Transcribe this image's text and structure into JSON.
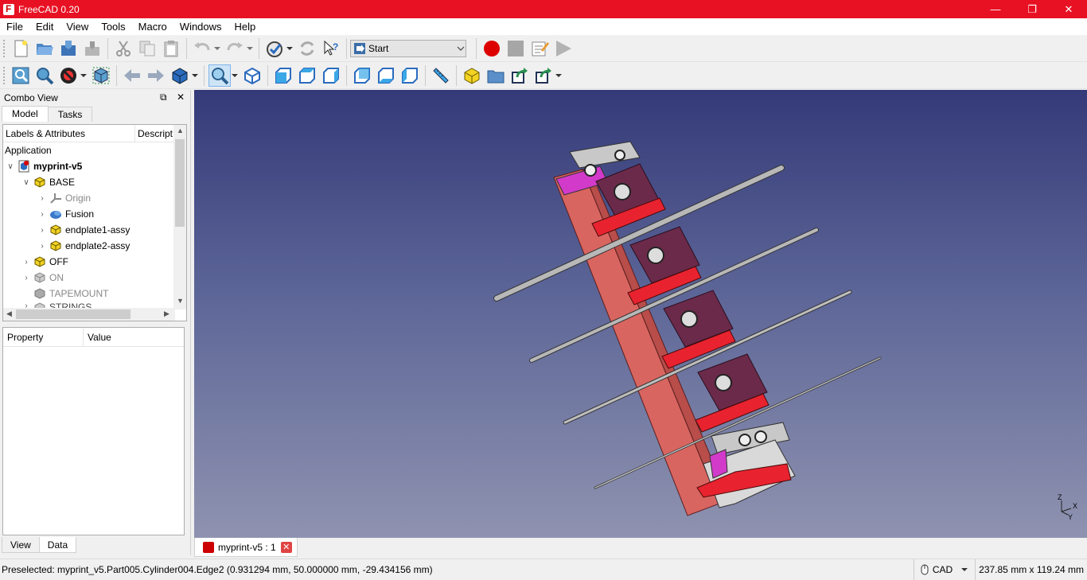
{
  "app": {
    "title": "FreeCAD 0.20"
  },
  "window_controls": {
    "minimize": "—",
    "restore": "❐",
    "close": "✕"
  },
  "menu": [
    "File",
    "Edit",
    "View",
    "Tools",
    "Macro",
    "Windows",
    "Help"
  ],
  "toolbar": {
    "workbench": "Start"
  },
  "combo_view": {
    "title": "Combo View",
    "tabs": [
      "Model",
      "Tasks"
    ],
    "tree_headers": [
      "Labels & Attributes",
      "Descript"
    ],
    "tree_root_label": "Application",
    "tree_items": [
      {
        "label": "myprint-v5",
        "icon": "document-icon"
      },
      {
        "label": "BASE",
        "icon": "part-icon"
      },
      {
        "label": "Origin",
        "icon": "origin-icon"
      },
      {
        "label": "Fusion",
        "icon": "fusion-icon"
      },
      {
        "label": "endplate1-assy",
        "icon": "part-icon"
      },
      {
        "label": "endplate2-assy",
        "icon": "part-icon"
      },
      {
        "label": "OFF",
        "icon": "part-icon"
      },
      {
        "label": "ON",
        "icon": "part-icon"
      },
      {
        "label": "TAPEMOUNT",
        "icon": "body-icon"
      },
      {
        "label": "STRINGS",
        "icon": "part-icon"
      }
    ],
    "property_headers": [
      "Property",
      "Value"
    ],
    "bottom_tabs": [
      "View",
      "Data"
    ]
  },
  "document_tab": {
    "label": "myprint-v5 : 1"
  },
  "axis_labels": {
    "z": "Z",
    "x": "X",
    "y": "Y"
  },
  "status": {
    "message": "Preselected: myprint_v5.Part005.Cylinder004.Edge2 (0.931294 mm, 50.000000 mm, -29.434156 mm)",
    "navigation_style": "CAD",
    "dimensions": "237.85 mm x 119.24 mm"
  },
  "colors": {
    "titlebar": "#e81123",
    "viewport_top": "#343a78",
    "viewport_bottom": "#8f93b0",
    "model_red": "#e8232f",
    "model_salmon": "#d96560",
    "model_purple": "#6b2a4a",
    "model_magenta": "#d23ac9"
  }
}
